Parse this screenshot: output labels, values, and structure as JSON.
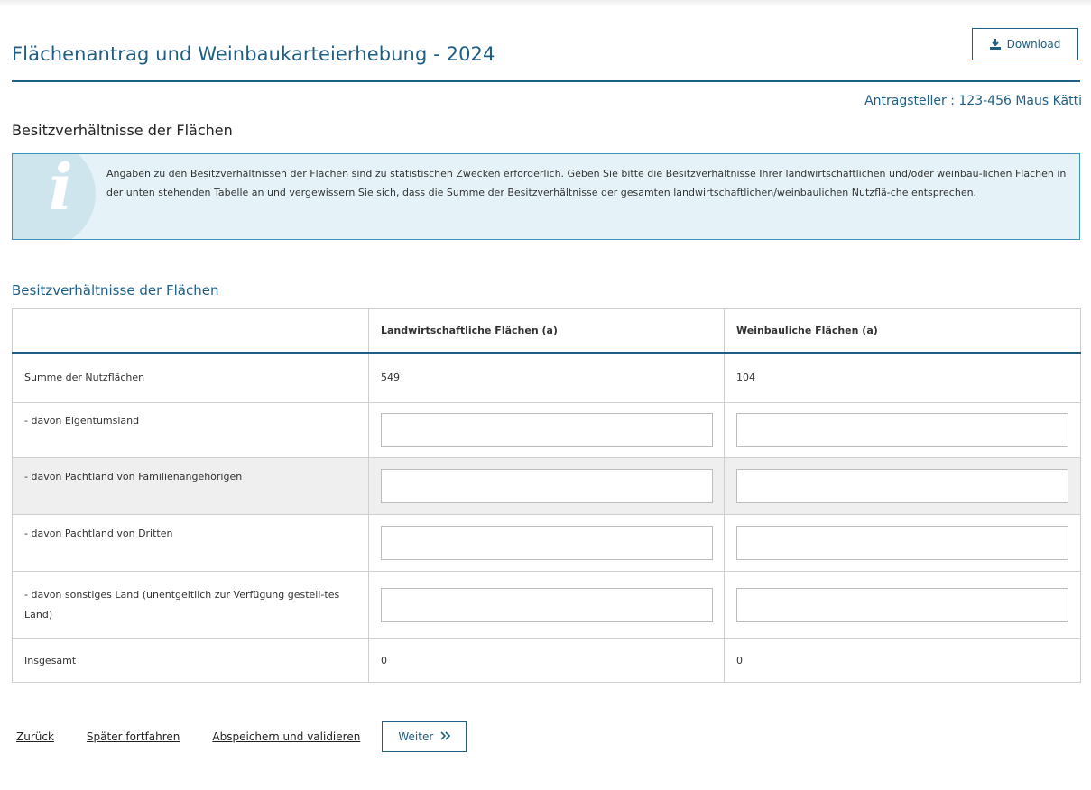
{
  "header": {
    "title": "Flächenantrag und Weinbaukarteierhebung - 2024",
    "download_label": "Download",
    "applicant": "Antragsteller : 123-456 Maus Kätti"
  },
  "section": {
    "heading": "Besitzverhältnisse der Flächen"
  },
  "info": {
    "icon": "info-icon",
    "text": "Angaben zu den Besitzverhältnissen der Flächen sind zu statistischen Zwecken erforderlich. Geben Sie bitte die Besitzverhältnisse Ihrer landwirtschaftlichen und/oder weinbau-lichen Flächen in der unten stehenden Tabelle an und vergewissern Sie sich, dass die Summe der Besitzverhältnisse der gesamten landwirtschaftlichen/weinbaulichen Nutzflä-che entsprechen."
  },
  "table": {
    "heading": "Besitzverhältnisse der Flächen",
    "columns": [
      "",
      "Landwirtschaftliche Flächen (a)",
      "Weinbauliche Flächen (a)"
    ],
    "sum_row": {
      "label": "Summe der Nutzflächen",
      "agri": "549",
      "wine": "104"
    },
    "rows": [
      {
        "label": " - davon Eigentumsland",
        "agri_value": "",
        "wine_value": ""
      },
      {
        "label": " - davon Pachtland von Familienangehörigen",
        "agri_value": "",
        "wine_value": ""
      },
      {
        "label": " - davon Pachtland von Dritten",
        "agri_value": "",
        "wine_value": ""
      },
      {
        "label": " - davon sonstiges Land (unentgeltlich zur Verfügung gestell-tes Land)",
        "agri_value": "",
        "wine_value": ""
      }
    ],
    "total_row": {
      "label": "Insgesamt",
      "agri": "0",
      "wine": "0"
    }
  },
  "footer": {
    "back_label": "Zurück",
    "later_label": "Später fortfahren",
    "save_label": "Abspeichern und validieren",
    "next_label": "Weiter",
    "next_icon": "double-chevron-right-icon"
  },
  "colors": {
    "accent": "#1f5f86",
    "info_border": "#3f95b9",
    "info_bg": "#e5f3f8",
    "shaded_row": "#efefef"
  }
}
